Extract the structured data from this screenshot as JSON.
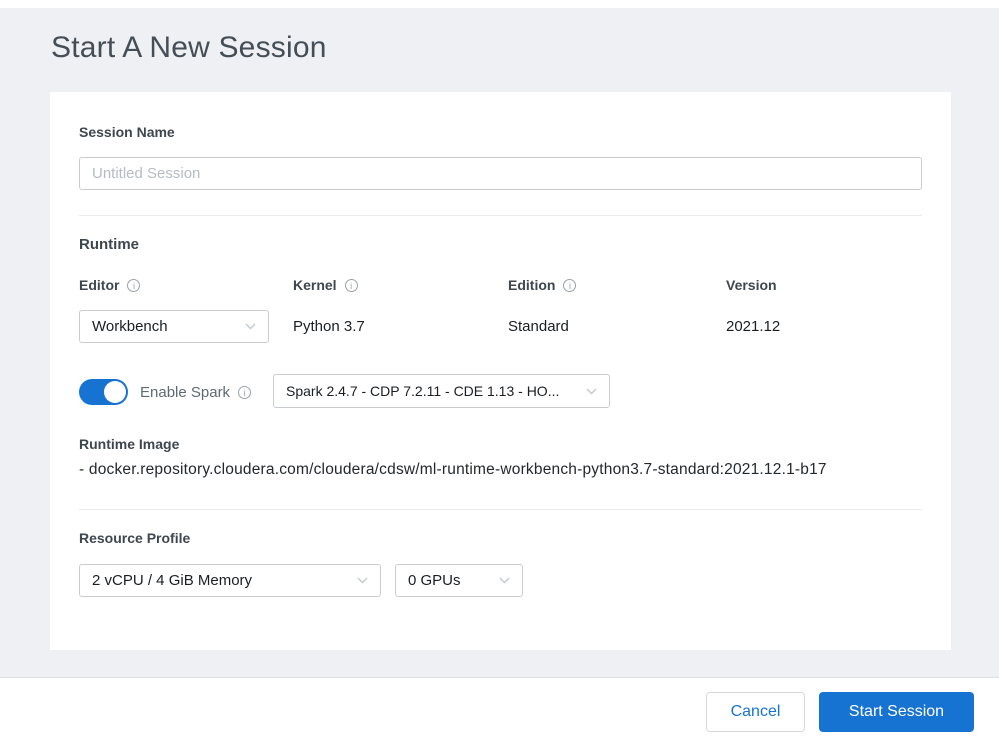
{
  "page": {
    "title": "Start A New Session"
  },
  "form": {
    "session_name": {
      "label": "Session Name",
      "placeholder": "Untitled Session",
      "value": ""
    },
    "runtime": {
      "label": "Runtime",
      "editor": {
        "label": "Editor",
        "value": "Workbench"
      },
      "kernel": {
        "label": "Kernel",
        "value": "Python 3.7"
      },
      "edition": {
        "label": "Edition",
        "value": "Standard"
      },
      "version": {
        "label": "Version",
        "value": "2021.12"
      },
      "spark": {
        "label": "Enable Spark",
        "enabled": true,
        "value": "Spark 2.4.7 - CDP 7.2.11 - CDE 1.13 - HO..."
      },
      "runtime_image": {
        "label": "Runtime Image",
        "value": "- docker.repository.cloudera.com/cloudera/cdsw/ml-runtime-workbench-python3.7-standard:2021.12.1-b17"
      }
    },
    "resource_profile": {
      "label": "Resource Profile",
      "cpu_memory": "2 vCPU / 4 GiB Memory",
      "gpus": "0 GPUs"
    }
  },
  "footer": {
    "cancel_label": "Cancel",
    "start_label": "Start Session"
  },
  "colors": {
    "accent_blue": "#1673d2",
    "background": "#eef0f3"
  }
}
